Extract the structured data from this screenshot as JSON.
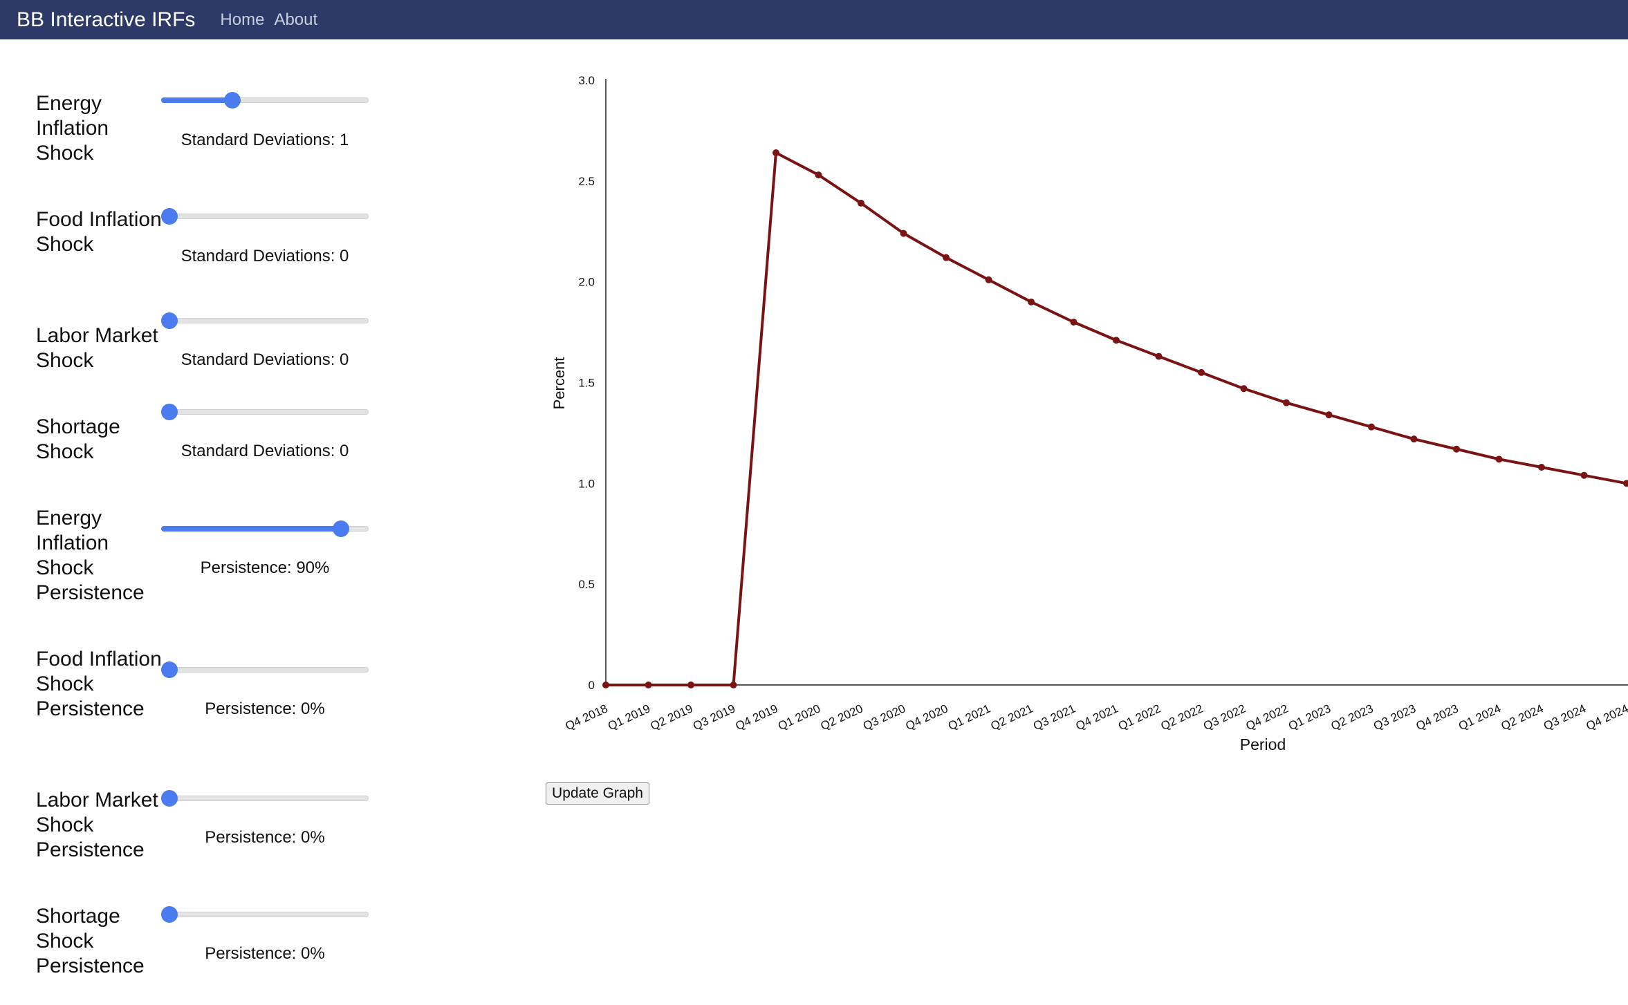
{
  "navbar": {
    "brand": "BB Interactive IRFs",
    "links": [
      "Home",
      "About"
    ]
  },
  "controls": [
    {
      "label": "Energy Inflation Shock",
      "value_text": "Standard Deviations: 1",
      "fraction": 0.33
    },
    {
      "label": "Food Inflation Shock",
      "value_text": "Standard Deviations: 0",
      "fraction": 0.0
    },
    {
      "label": "Labor Market Shock",
      "value_text": "Standard Deviations: 0",
      "fraction": 0.0
    },
    {
      "label": "Shortage Shock",
      "value_text": "Standard Deviations: 0",
      "fraction": 0.0
    },
    {
      "label": "Energy Inflation Shock Persistence",
      "value_text": "Persistence: 90%",
      "fraction": 0.9
    },
    {
      "label": "Food Inflation Shock Persistence",
      "value_text": "Persistence: 0%",
      "fraction": 0.0
    },
    {
      "label": "Labor Market Shock Persistence",
      "value_text": "Persistence: 0%",
      "fraction": 0.0
    },
    {
      "label": "Shortage Shock Persistence",
      "value_text": "Persistence: 0%",
      "fraction": 0.0
    }
  ],
  "update_button": "Update Graph",
  "chart_data": {
    "type": "line",
    "xlabel": "Period",
    "ylabel": "Percent",
    "ylim": [
      0,
      3.0
    ],
    "yticks": [
      "0",
      "0.5",
      "1.0",
      "1.5",
      "2.0",
      "2.5",
      "3.0"
    ],
    "grid": false,
    "color": "#7a1414",
    "categories": [
      "Q4 2018",
      "Q1 2019",
      "Q2 2019",
      "Q3 2019",
      "Q4 2019",
      "Q1 2020",
      "Q2 2020",
      "Q3 2020",
      "Q4 2020",
      "Q1 2021",
      "Q2 2021",
      "Q3 2021",
      "Q4 2021",
      "Q1 2022",
      "Q2 2022",
      "Q3 2022",
      "Q4 2022",
      "Q1 2023",
      "Q2 2023",
      "Q3 2023",
      "Q4 2023",
      "Q1 2024",
      "Q2 2024",
      "Q3 2024",
      "Q4 2024"
    ],
    "values": [
      0,
      0,
      0,
      0,
      2.64,
      2.53,
      2.39,
      2.24,
      2.12,
      2.01,
      1.9,
      1.8,
      1.71,
      1.63,
      1.55,
      1.47,
      1.4,
      1.34,
      1.28,
      1.22,
      1.17,
      1.12,
      1.08,
      1.04,
      1.0
    ]
  }
}
